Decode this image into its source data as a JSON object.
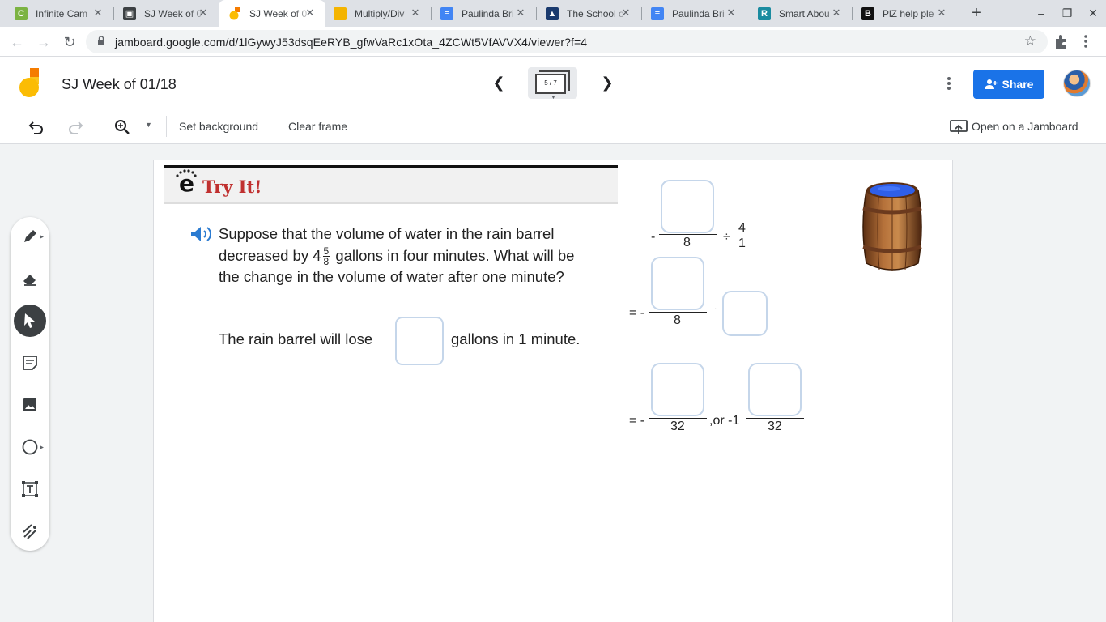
{
  "browser": {
    "tabs": [
      {
        "title": "Infinite Cam",
        "icon": "camera-c-icon",
        "color": "#7cb342"
      },
      {
        "title": "SJ Week of 0",
        "icon": "classroom-icon",
        "color": "#3c4043"
      },
      {
        "title": "SJ Week of 0",
        "icon": "jamboard-icon",
        "color": "#fbbc04",
        "active": true
      },
      {
        "title": "Multiply/Div",
        "icon": "slides-icon",
        "color": "#f4b400"
      },
      {
        "title": "Paulinda Bri",
        "icon": "docs-icon",
        "color": "#4285f4"
      },
      {
        "title": "The School o",
        "icon": "school-icon",
        "color": "#1a3a6e"
      },
      {
        "title": "Paulinda Bri",
        "icon": "docs-icon",
        "color": "#4285f4"
      },
      {
        "title": "Smart Abou",
        "icon": "r-icon",
        "color": "#1a8ba0"
      },
      {
        "title": "PlZ help ple",
        "icon": "brainly-icon",
        "color": "#111111"
      }
    ],
    "url": "jamboard.google.com/d/1lGywyJ53dsqEeRYB_gfwVaRc1xOta_4ZCWt5VfAVVX4/viewer?f=4"
  },
  "header": {
    "title": "SJ Week of 01/18",
    "frame_indicator": "5 / 7",
    "share_label": "Share"
  },
  "toolbar": {
    "set_background": "Set background",
    "clear_frame": "Clear frame",
    "open_on_jamboard": "Open on a Jamboard"
  },
  "sidepanel": {
    "tools": [
      "pen-icon",
      "eraser-icon",
      "select-icon",
      "sticky-note-icon",
      "image-icon",
      "circle-icon",
      "text-box-icon",
      "laser-icon"
    ],
    "active_tool": "select-icon"
  },
  "content": {
    "heading": "Try It!",
    "problem_line1": "Suppose that the volume of water in the rain barrel",
    "problem_line2a": "decreased by 4",
    "problem_whole": "4",
    "problem_num": "5",
    "problem_den": "8",
    "problem_line2b": " gallons in four minutes. What will be",
    "problem_line3": "the change in the volume of water after one minute?",
    "answer_pre": "The rain barrel will lose",
    "answer_post": "gallons in 1 minute.",
    "eq1": {
      "prefix": "-",
      "den": "8",
      "op": "÷",
      "num2": "4",
      "den2": "1"
    },
    "eq2": {
      "prefix": "= -",
      "den": "8",
      "op": "·"
    },
    "eq3": {
      "prefix": "= -",
      "den": "32",
      "mid": ",or -1",
      "den2": "32"
    }
  }
}
